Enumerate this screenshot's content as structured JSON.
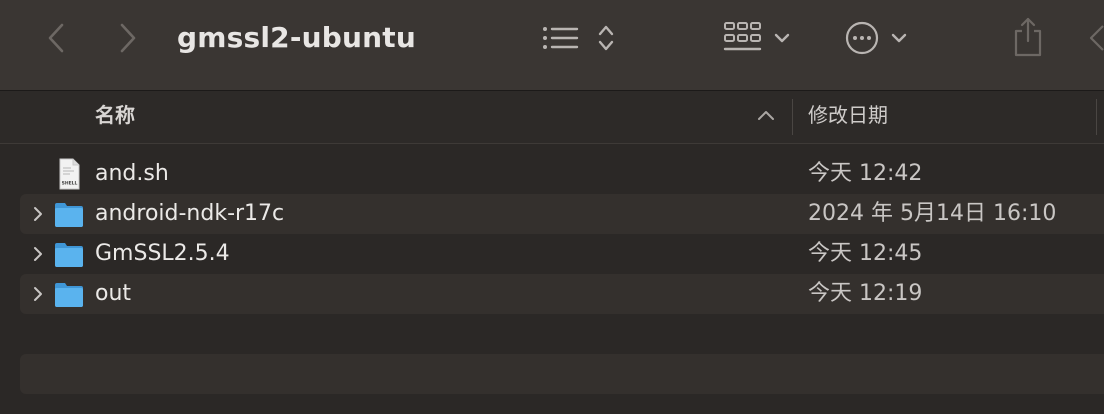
{
  "window": {
    "title": "gmssl2-ubuntu"
  },
  "toolbar": {
    "back_icon": "chevron-left-icon",
    "forward_icon": "chevron-right-icon",
    "view_list_icon": "list-icon",
    "view_grid_icon": "grid-icon",
    "more_icon": "ellipsis-circle-icon",
    "share_icon": "share-icon"
  },
  "columns": {
    "name": "名称",
    "date": "修改日期",
    "sort_direction": "ascending"
  },
  "files": [
    {
      "name": "and.sh",
      "date": "今天 12:42",
      "kind": "shell-script",
      "expandable": false
    },
    {
      "name": "android-ndk-r17c",
      "date": "2024 年 5月14日 16:10",
      "kind": "folder",
      "expandable": true
    },
    {
      "name": "GmSSL2.5.4",
      "date": "今天 12:45",
      "kind": "folder",
      "expandable": true
    },
    {
      "name": "out",
      "date": "今天 12:19",
      "kind": "folder",
      "expandable": true
    }
  ],
  "colors": {
    "folder": "#5ab3ee",
    "background": "#2b2826",
    "toolbar": "#3a3633",
    "row_alt": "#34302d"
  }
}
